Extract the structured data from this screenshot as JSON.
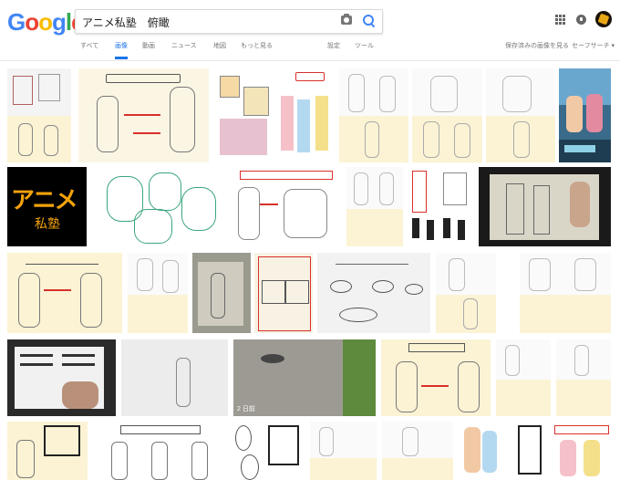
{
  "logo": {
    "letters": [
      "G",
      "o",
      "o",
      "g",
      "l",
      "e"
    ],
    "colors": [
      "#4285f4",
      "#ea4335",
      "#fbbc05",
      "#4285f4",
      "#34a853",
      "#ea4335"
    ]
  },
  "search": {
    "query": "アニメ私塾　俯瞰"
  },
  "tabs": [
    "すべて",
    "画像",
    "動画",
    "ニュース",
    "地図",
    "もっと見る"
  ],
  "active_tab": "画像",
  "tools": [
    "設定",
    "ツール"
  ],
  "right_links": [
    "保存済みの画像を見る",
    "セーフサーチ ▾"
  ],
  "thumbs": {
    "anime_logo_text": "アニメ",
    "anime_logo_sub": "私塾",
    "video_badge": "2 日前"
  },
  "colors": {
    "accent": "#1a73e8",
    "paper": "#f7efcc",
    "pencil": "#cfcfcf",
    "red": "#d9302a"
  }
}
